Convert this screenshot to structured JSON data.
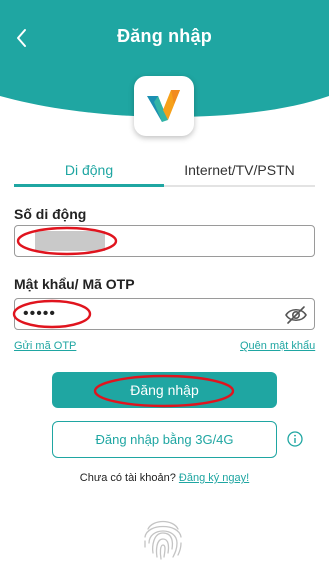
{
  "header": {
    "title": "Đăng nhập",
    "bg_color": "#1fa6a2"
  },
  "tabs": [
    {
      "label": "Di động",
      "active": true
    },
    {
      "label": "Internet/TV/PSTN",
      "active": false
    }
  ],
  "phone": {
    "label": "Số di động",
    "value": ""
  },
  "password": {
    "label": "Mật khẩu/ Mã OTP",
    "value": "•••••"
  },
  "links": {
    "send_otp": "Gửi mã OTP",
    "forgot_password": "Quên mật khẩu"
  },
  "buttons": {
    "login": "Đăng nhập",
    "login_3g4g": "Đăng nhập bằng 3G/4G"
  },
  "register": {
    "prompt": "Chưa có tài khoản?",
    "link": "Đăng ký ngay!"
  },
  "colors": {
    "accent": "#1fa6a2",
    "annotation": "#e0141e"
  },
  "icons": [
    "back-arrow-icon",
    "app-logo",
    "eye-hidden-icon",
    "info-icon",
    "fingerprint-icon"
  ]
}
